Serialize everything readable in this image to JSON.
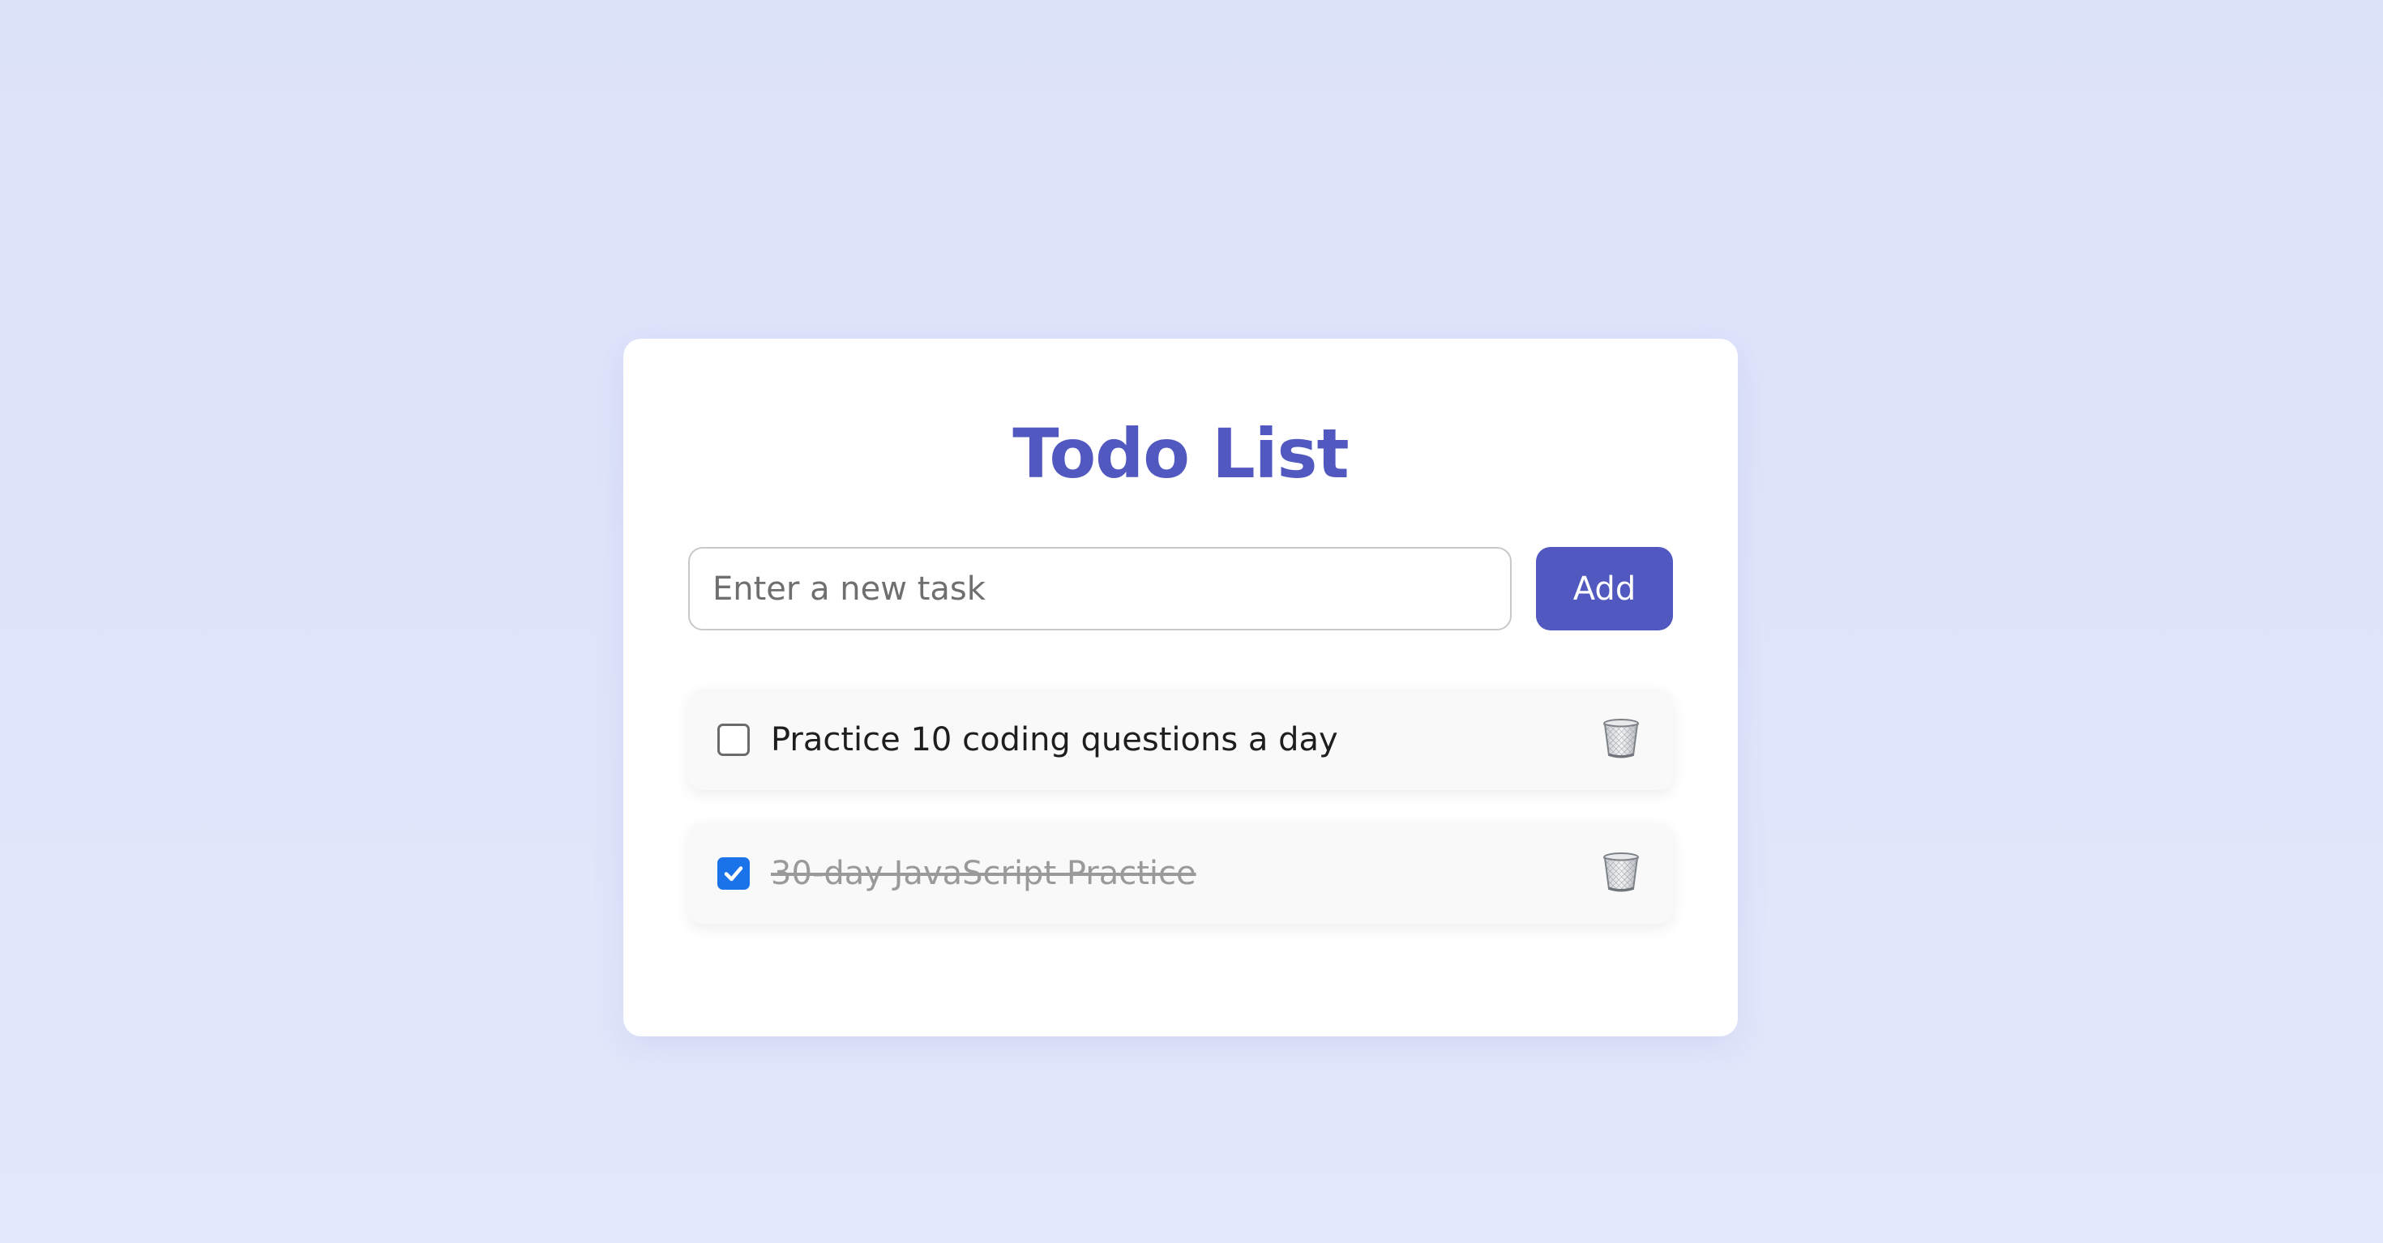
{
  "app": {
    "title": "Todo List",
    "accent_color": "#5158c0",
    "background_color": "#dfe3fb"
  },
  "new_task": {
    "placeholder": "Enter a new task",
    "value": "",
    "add_label": "Add"
  },
  "todos": [
    {
      "text": "Practice 10 coding questions a day",
      "completed": false,
      "delete_icon": "trash-icon"
    },
    {
      "text": "30-day JavaScript Practice",
      "completed": true,
      "delete_icon": "trash-icon"
    }
  ]
}
